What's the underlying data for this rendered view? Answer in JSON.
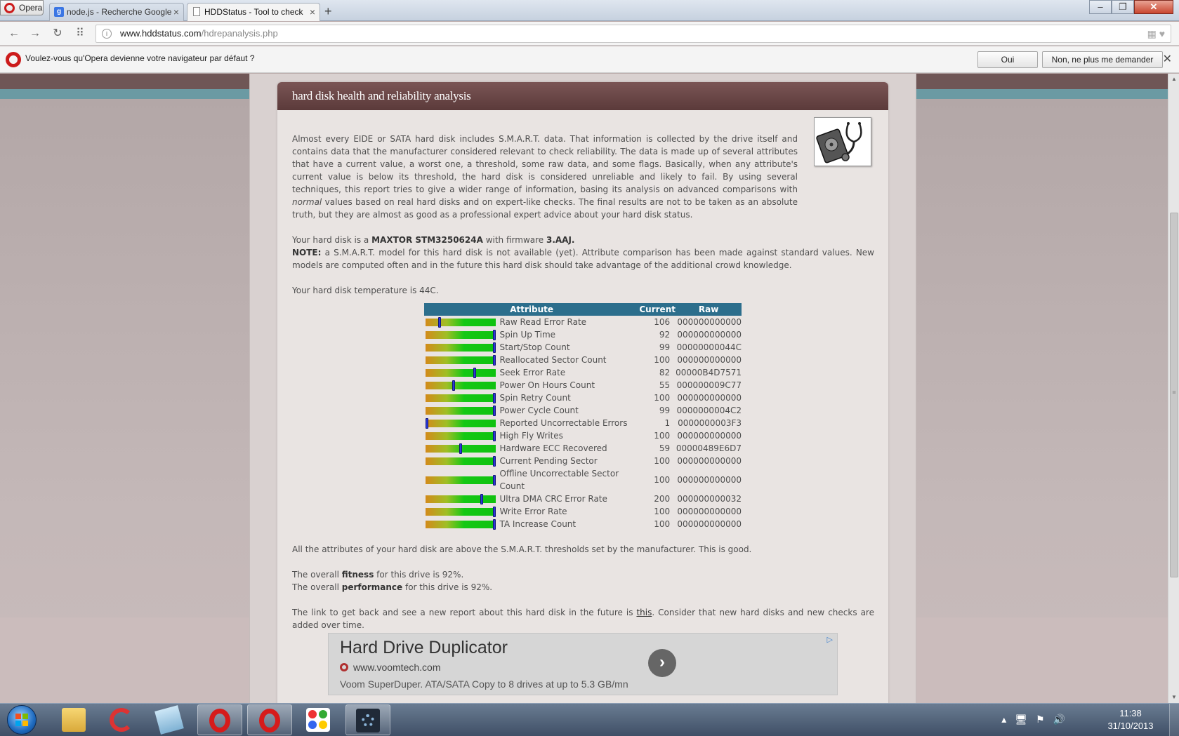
{
  "browser": {
    "menu_label": "Opera",
    "tabs": [
      {
        "label": "node.js - Recherche Google",
        "favicon": "google-icon"
      },
      {
        "label": "HDDStatus - Tool to check",
        "favicon": "page-icon"
      }
    ],
    "new_tab": "+",
    "url_domain": "www.hddstatus.com",
    "url_path": "/hdrepanalysis.php",
    "infobar": {
      "message": "Voulez-vous qu'Opera devienne votre navigateur par défaut ?",
      "yes_label": "Oui",
      "no_label": "Non, ne plus me demander"
    }
  },
  "page": {
    "heading": "hard disk health and reliability analysis",
    "intro_1": "Almost every EIDE or SATA hard disk includes S.M.A.R.T. data. That information is collected by the drive itself and contains data that the manufacturer considered relevant to check reliability. The data is made up of several attributes that have a current value, a worst one, a threshold, some raw data, and some flags. Basically, when any attribute's current value is below its threshold, the hard disk is considered unreliable and likely to fail. By using several techniques, this report tries to give a wider range of information, basing its analysis on advanced comparisons with ",
    "intro_em": "normal",
    "intro_2": " values based on real hard disks and on expert-like checks. The final results are not to be taken as an absolute truth, but they are almost as good as a professional expert advice about your hard disk status.",
    "disk_prefix": "Your hard disk is a ",
    "disk_model": "MAXTOR STM3250624A",
    "disk_mid": " with firmware ",
    "disk_firmware": "3.AAJ.",
    "note_label": "NOTE:",
    "note_text": " a S.M.A.R.T. model for this hard disk is not available (yet). Attribute comparison has been made against standard values. New models are computed often and in the future this hard disk should take advantage of the additional crowd knowledge.",
    "temperature": "Your hard disk temperature is 44C.",
    "table_headers": {
      "attribute": "Attribute",
      "current": "Current",
      "raw": "Raw"
    },
    "attributes": [
      {
        "name": "Raw Read Error Rate",
        "current": "106",
        "raw": "000000000000",
        "level": 0.2
      },
      {
        "name": "Spin Up Time",
        "current": "92",
        "raw": "000000000000",
        "level": 1.0
      },
      {
        "name": "Start/Stop Count",
        "current": "99",
        "raw": "00000000044C",
        "level": 1.0
      },
      {
        "name": "Reallocated Sector Count",
        "current": "100",
        "raw": "000000000000",
        "level": 1.0
      },
      {
        "name": "Seek Error Rate",
        "current": "82",
        "raw": "00000B4D7571",
        "level": 0.7
      },
      {
        "name": "Power On Hours Count",
        "current": "55",
        "raw": "000000009C77",
        "level": 0.4
      },
      {
        "name": "Spin Retry Count",
        "current": "100",
        "raw": "000000000000",
        "level": 1.0
      },
      {
        "name": "Power Cycle Count",
        "current": "99",
        "raw": "0000000004C2",
        "level": 1.0
      },
      {
        "name": "Reported Uncorrectable Errors",
        "current": "1",
        "raw": "0000000003F3",
        "level": 0.0
      },
      {
        "name": "High Fly Writes",
        "current": "100",
        "raw": "000000000000",
        "level": 1.0
      },
      {
        "name": "Hardware ECC Recovered",
        "current": "59",
        "raw": "00000489E6D7",
        "level": 0.5
      },
      {
        "name": "Current Pending Sector",
        "current": "100",
        "raw": "000000000000",
        "level": 1.0
      },
      {
        "name": "Offline Uncorrectable Sector Count",
        "current": "100",
        "raw": "000000000000",
        "level": 1.0
      },
      {
        "name": "Ultra DMA CRC Error Rate",
        "current": "200",
        "raw": "000000000032",
        "level": 0.8
      },
      {
        "name": "Write Error Rate",
        "current": "100",
        "raw": "000000000000",
        "level": 1.0
      },
      {
        "name": "TA Increase Count",
        "current": "100",
        "raw": "000000000000",
        "level": 1.0
      }
    ],
    "above_threshold": "All the attributes of your hard disk are above the S.M.A.R.T. thresholds set by the manufacturer. This is good.",
    "fitness_prefix": "The overall ",
    "fitness_label": "fitness",
    "fitness_suffix": " for this drive is 92%.",
    "performance_prefix": "The overall ",
    "performance_label": "performance",
    "performance_suffix": " for this drive is 92%.",
    "link_prefix": "The link to get back and see a new report about this hard disk in the future is ",
    "link_text": "this",
    "link_suffix": ". Consider that new hard disks and new checks are added over time."
  },
  "ad": {
    "title": "Hard Drive Duplicator",
    "url": "www.voomtech.com",
    "description": "Voom SuperDuper. ATA/SATA Copy to 8 drives at up to 5.3 GB/mn",
    "arrow": "›",
    "choices": "▷"
  },
  "taskbar": {
    "time": "11:38",
    "date": "31/10/2013"
  },
  "colors": {
    "header_brown": "#5b3a3a",
    "table_header": "#2c6e8c",
    "bar_marker": "#2b39d8"
  }
}
